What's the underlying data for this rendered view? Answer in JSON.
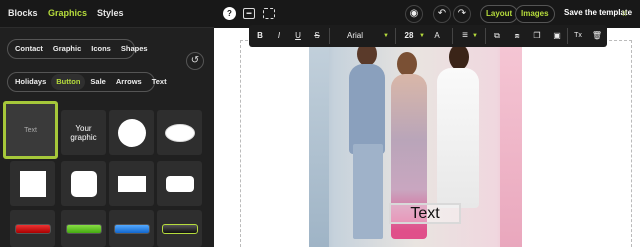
{
  "left_panel": {
    "tabs": [
      "Blocks",
      "Graphics",
      "Styles"
    ],
    "active_tab": "Graphics",
    "categories": [
      "Contact",
      "Graphic",
      "Icons",
      "Shapes"
    ],
    "subcategories": [
      "Holidays",
      "Button",
      "Sale",
      "Arrows",
      "Text"
    ],
    "active_subcategory": "Button",
    "tiles": {
      "text_tile": "Text",
      "graphic_tile": "Your graphic"
    }
  },
  "top_bar": {
    "layout_label": "Layout",
    "images_label": "Images",
    "save_label": "Save the template",
    "help_label": "?"
  },
  "text_toolbar": {
    "bold": "B",
    "italic": "I",
    "underline": "U",
    "strike": "S",
    "font": "Arial",
    "size": "28",
    "color_label": "A",
    "clear_format": "Tx"
  },
  "canvas": {
    "text_element": "Text"
  },
  "colors": {
    "accent": "#b6dc3c",
    "panel": "#202020",
    "bar": "#181818"
  }
}
